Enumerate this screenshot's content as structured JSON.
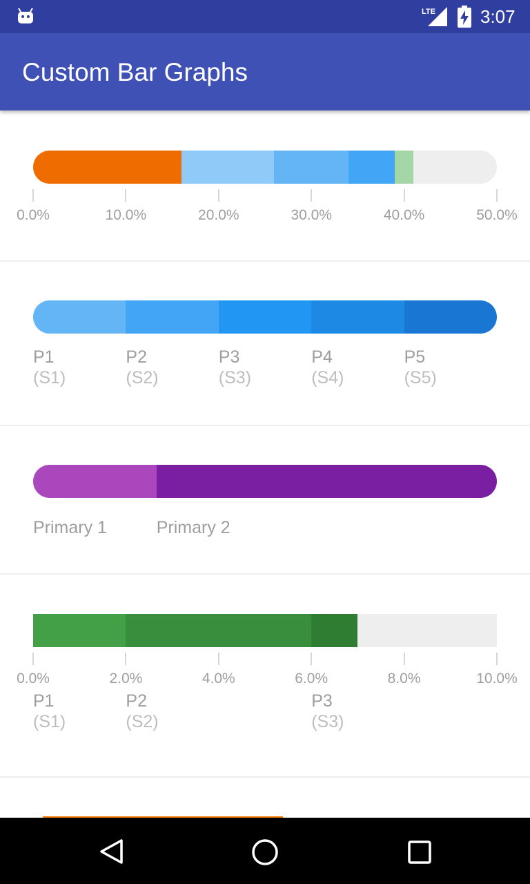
{
  "status_bar": {
    "time": "3:07",
    "network": "LTE"
  },
  "app_bar": {
    "title": "Custom Bar Graphs"
  },
  "graphs": [
    {
      "style": "rounded",
      "scale_max_percent": 50,
      "segments": [
        {
          "value": 16.0,
          "color": "#ef6c00"
        },
        {
          "value": 10.0,
          "color": "#90caf9"
        },
        {
          "value": 8.0,
          "color": "#64b5f6"
        },
        {
          "value": 5.0,
          "color": "#42a5f5"
        },
        {
          "value": 2.0,
          "color": "#a5d6a7"
        }
      ],
      "ticks": [
        {
          "value": 0,
          "label": "0.0%"
        },
        {
          "value": 10,
          "label": "10.0%"
        },
        {
          "value": 20,
          "label": "20.0%"
        },
        {
          "value": 30,
          "label": "30.0%"
        },
        {
          "value": 40,
          "label": "40.0%"
        },
        {
          "value": 50,
          "label": "50.0%"
        }
      ],
      "labels": []
    },
    {
      "style": "rounded",
      "scale_max_percent": 100,
      "segments": [
        {
          "value": 20,
          "color": "#64b5f6"
        },
        {
          "value": 20,
          "color": "#42a5f5"
        },
        {
          "value": 20,
          "color": "#2196f3"
        },
        {
          "value": 20,
          "color": "#1e88e5"
        },
        {
          "value": 20,
          "color": "#1976d2"
        }
      ],
      "ticks": [],
      "labels": [
        {
          "primary": "P1",
          "secondary": "(S1)"
        },
        {
          "primary": "P2",
          "secondary": "(S2)"
        },
        {
          "primary": "P3",
          "secondary": "(S3)"
        },
        {
          "primary": "P4",
          "secondary": "(S4)"
        },
        {
          "primary": "P5",
          "secondary": "(S5)"
        }
      ]
    },
    {
      "style": "rounded",
      "scale_max_percent": 100,
      "segments": [
        {
          "value": 26.6,
          "color": "#ab47bc"
        },
        {
          "value": 73.4,
          "color": "#7b1fa2"
        }
      ],
      "ticks": [],
      "labels": [
        {
          "primary": "Primary 1",
          "secondary": ""
        },
        {
          "primary": "Primary 2",
          "secondary": ""
        }
      ]
    },
    {
      "style": "square",
      "scale_max_percent": 10,
      "segments": [
        {
          "value": 2.0,
          "color": "#43a047"
        },
        {
          "value": 4.0,
          "color": "#388e3c"
        },
        {
          "value": 1.0,
          "color": "#2e7d32"
        }
      ],
      "ticks": [
        {
          "value": 0,
          "label": "0.0%"
        },
        {
          "value": 2,
          "label": "2.0%"
        },
        {
          "value": 4,
          "label": "4.0%"
        },
        {
          "value": 6,
          "label": "6.0%"
        },
        {
          "value": 8,
          "label": "8.0%"
        },
        {
          "value": 10,
          "label": "10.0%"
        }
      ],
      "labels": [
        {
          "primary": "P1",
          "secondary": "(S1)"
        },
        {
          "primary": "P2",
          "secondary": "(S2)"
        },
        {
          "primary": "P3",
          "secondary": "(S3)"
        }
      ]
    },
    {
      "style": "square",
      "scale_max_percent": 100,
      "segments": [
        {
          "value": 54,
          "color": "#f57c00"
        }
      ],
      "ticks": [],
      "labels": []
    }
  ],
  "nav_bar": {
    "buttons": [
      "back-icon",
      "home-icon",
      "recents-icon"
    ]
  }
}
